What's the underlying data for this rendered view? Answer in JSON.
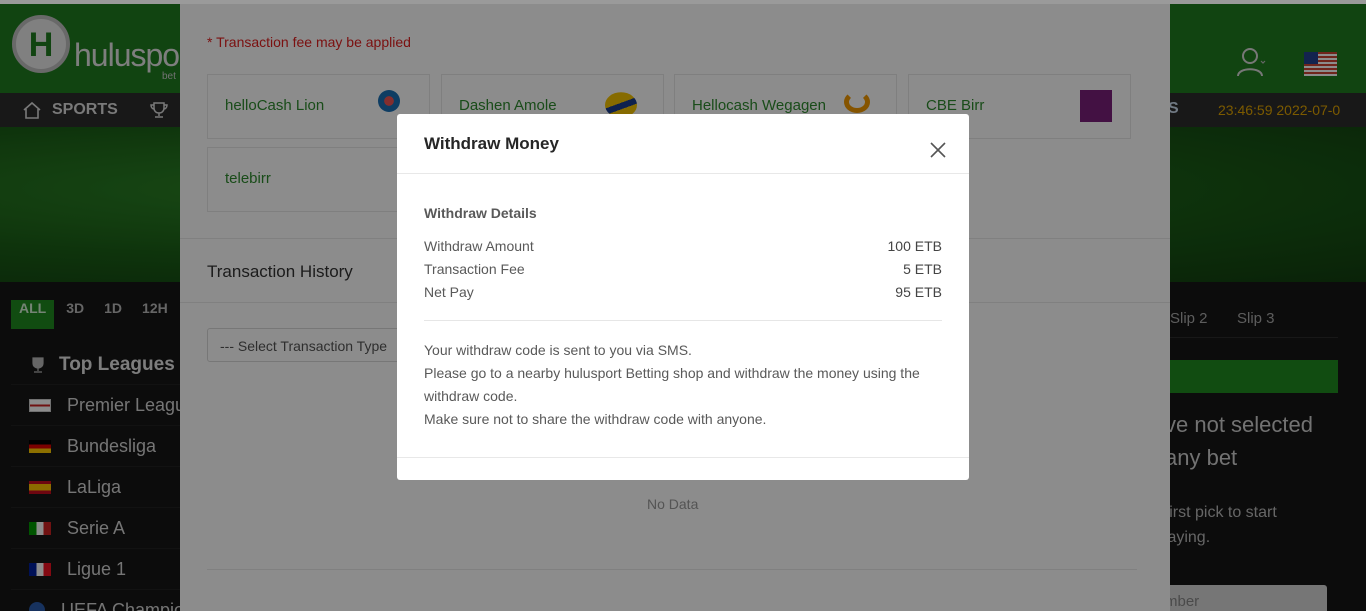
{
  "site": {
    "logo_letter": "H",
    "logo_text": "hulusport",
    "logo_sub": "bet",
    "nav_sports": "SPORTS",
    "nav_right_label": "S",
    "clock": "23:46:59 2022-07-0",
    "time_filters": [
      "ALL",
      "3D",
      "1D",
      "12H"
    ],
    "top_leagues_title": "Top Leagues",
    "leagues": [
      "Premier League",
      "Bundesliga",
      "LaLiga",
      "Serie A",
      "Ligue 1",
      "UEFA Champions League"
    ],
    "slip_tabs": [
      "Slip 2",
      "Slip 3"
    ],
    "slip_empty": "ve not selected any bet",
    "slip_hint": "r first pick to start playing.",
    "slip_input_placeholder": "mber"
  },
  "panel": {
    "fee_note": "* Transaction fee may be applied",
    "payment_methods": [
      {
        "name": "helloCash Lion"
      },
      {
        "name": "Dashen Amole"
      },
      {
        "name": "Hellocash Wegagen"
      },
      {
        "name": "CBE Birr"
      },
      {
        "name": "telebirr"
      }
    ],
    "history_title": "Transaction History",
    "select_placeholder": "--- Select Transaction Type",
    "no_data": "No Data"
  },
  "modal": {
    "title": "Withdraw Money",
    "details_title": "Withdraw Details",
    "rows": [
      {
        "label": "Withdraw Amount",
        "value": "100 ETB"
      },
      {
        "label": "Transaction Fee",
        "value": "5 ETB"
      },
      {
        "label": "Net Pay",
        "value": "95 ETB"
      }
    ],
    "message_lines": [
      "Your withdraw code is sent to you via SMS.",
      "Please go to a nearby hulusport Betting shop and withdraw the money using the withdraw code.",
      "Make sure not to share the withdraw code with anyone."
    ]
  },
  "colors": {
    "brand_green": "#1f7d20",
    "accent_green": "#2e8b2e",
    "fee_red": "#e02020",
    "clock_orange": "#e0a400"
  }
}
